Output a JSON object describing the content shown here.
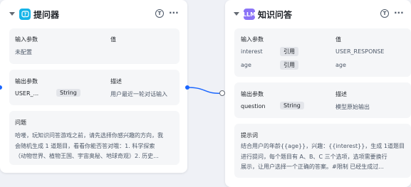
{
  "nodes": [
    {
      "title": "提问器",
      "icon": "question-bubble-icon",
      "accent": "#16b4e8",
      "input_section": {
        "header_param": "输入参数",
        "header_value": "值",
        "placeholder": "未配置"
      },
      "output_section": {
        "header_param": "输出参数",
        "header_desc": "描述",
        "rows": [
          {
            "name": "USER_...",
            "type": "String",
            "desc": "用户最近一轮对话输入"
          }
        ]
      },
      "question_section": {
        "title": "问题",
        "lines": [
          "哈喽，玩知识问答游戏之前，请先选择你感兴趣的方向，我",
          "会随机生成 1 道题目，看看你能否答对哦：1. 科学探索",
          "（动物世界、植物王国、宇宙奥秘、地球奇观）2. 历史..."
        ]
      }
    },
    {
      "title": "知识问答",
      "icon": "llm-icon",
      "icon_text": "LLM",
      "accent": "#8b74f7",
      "input_section": {
        "header_param": "输入参数",
        "header_value": "值",
        "rows": [
          {
            "name": "interest",
            "tag": "引用",
            "value": "USER_RESPONSE"
          },
          {
            "name": "age",
            "tag": "引用",
            "value": "age"
          }
        ]
      },
      "output_section": {
        "header_param": "输出参数",
        "header_desc": "描述",
        "rows": [
          {
            "name": "question",
            "type": "String",
            "desc": "模型原始输出"
          }
        ]
      },
      "prompt_section": {
        "title": "提示词",
        "lines": [
          "结合用户的年龄{{age}}，兴趣：{{interest}}，生成 1道题目",
          "进行提问，每个题目有 A、B、C 三个选项，选项需要换行",
          "展示，让用户选择一个正确的答案。#限制 已经生成过..."
        ]
      }
    }
  ],
  "colors": {
    "canvas": "#eff1f6",
    "edge": "#1a66ff"
  }
}
